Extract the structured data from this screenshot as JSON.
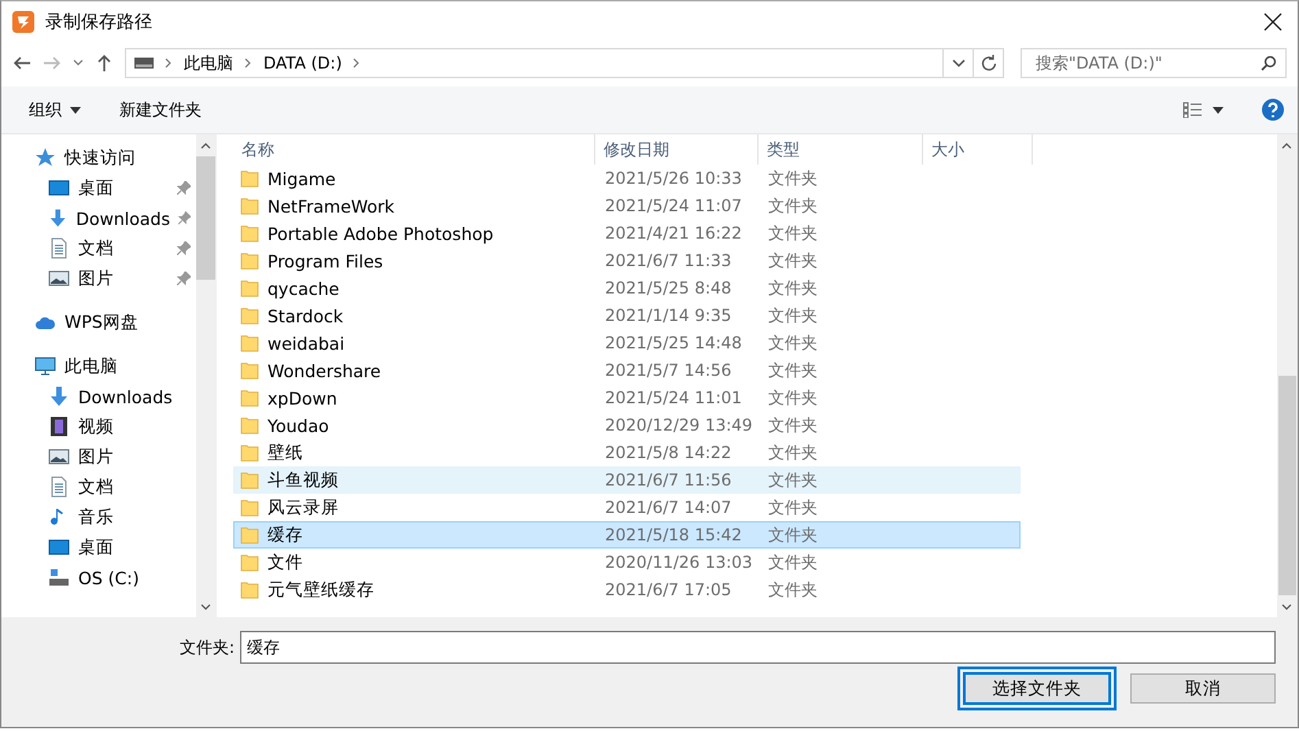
{
  "window": {
    "title": "录制保存路径"
  },
  "address": {
    "crumbs": [
      "此电脑",
      "DATA (D:)"
    ]
  },
  "search": {
    "placeholder": "搜索\"DATA (D:)\""
  },
  "toolbar": {
    "organize": "组织",
    "new_folder": "新建文件夹"
  },
  "sidebar": {
    "sections": [
      {
        "label": "快速访问",
        "kind": "star",
        "children": [
          {
            "label": "桌面",
            "kind": "desktop",
            "pinned": true
          },
          {
            "label": "Downloads",
            "kind": "download",
            "pinned": true
          },
          {
            "label": "文档",
            "kind": "document",
            "pinned": true
          },
          {
            "label": "图片",
            "kind": "picture",
            "pinned": true
          }
        ]
      },
      {
        "label": "WPS网盘",
        "kind": "cloud"
      },
      {
        "label": "此电脑",
        "kind": "computer",
        "children": [
          {
            "label": "Downloads",
            "kind": "download",
            "pinned": false
          },
          {
            "label": "视频",
            "kind": "video",
            "pinned": false
          },
          {
            "label": "图片",
            "kind": "picture",
            "pinned": false
          },
          {
            "label": "文档",
            "kind": "document",
            "pinned": false
          },
          {
            "label": "音乐",
            "kind": "music",
            "pinned": false
          },
          {
            "label": "桌面",
            "kind": "desktop",
            "pinned": false
          },
          {
            "label": "OS (C:)",
            "kind": "drive",
            "pinned": false
          }
        ]
      }
    ]
  },
  "table": {
    "columns": [
      "名称",
      "修改日期",
      "类型",
      "大小"
    ],
    "rows": [
      {
        "name": "Migame",
        "date": "2021/5/26 10:33",
        "type": "文件夹",
        "hovered": false,
        "selected": false
      },
      {
        "name": "NetFrameWork",
        "date": "2021/5/24 11:07",
        "type": "文件夹",
        "hovered": false,
        "selected": false
      },
      {
        "name": "Portable Adobe Photoshop",
        "date": "2021/4/21 16:22",
        "type": "文件夹",
        "hovered": false,
        "selected": false
      },
      {
        "name": "Program Files",
        "date": "2021/6/7 11:33",
        "type": "文件夹",
        "hovered": false,
        "selected": false
      },
      {
        "name": "qycache",
        "date": "2021/5/25 8:48",
        "type": "文件夹",
        "hovered": false,
        "selected": false
      },
      {
        "name": "Stardock",
        "date": "2021/1/14 9:35",
        "type": "文件夹",
        "hovered": false,
        "selected": false
      },
      {
        "name": "weidabai",
        "date": "2021/5/25 14:48",
        "type": "文件夹",
        "hovered": false,
        "selected": false
      },
      {
        "name": "Wondershare",
        "date": "2021/5/7 14:56",
        "type": "文件夹",
        "hovered": false,
        "selected": false
      },
      {
        "name": "xpDown",
        "date": "2021/5/24 11:01",
        "type": "文件夹",
        "hovered": false,
        "selected": false
      },
      {
        "name": "Youdao",
        "date": "2020/12/29 13:49",
        "type": "文件夹",
        "hovered": false,
        "selected": false
      },
      {
        "name": "壁纸",
        "date": "2021/5/8 14:22",
        "type": "文件夹",
        "hovered": false,
        "selected": false
      },
      {
        "name": "斗鱼视频",
        "date": "2021/6/7 11:56",
        "type": "文件夹",
        "hovered": true,
        "selected": false
      },
      {
        "name": "风云录屏",
        "date": "2021/6/7 14:07",
        "type": "文件夹",
        "hovered": false,
        "selected": false
      },
      {
        "name": "缓存",
        "date": "2021/5/18 15:42",
        "type": "文件夹",
        "hovered": false,
        "selected": true
      },
      {
        "name": "文件",
        "date": "2020/11/26 13:03",
        "type": "文件夹",
        "hovered": false,
        "selected": false
      },
      {
        "name": "元气壁纸缓存",
        "date": "2021/6/7 17:05",
        "type": "文件夹",
        "hovered": false,
        "selected": false
      }
    ]
  },
  "folder_field": {
    "label": "文件夹:",
    "value": "缓存"
  },
  "buttons": [
    {
      "label": "选择文件夹",
      "highlighted": true
    },
    {
      "label": "取消",
      "highlighted": false
    }
  ]
}
